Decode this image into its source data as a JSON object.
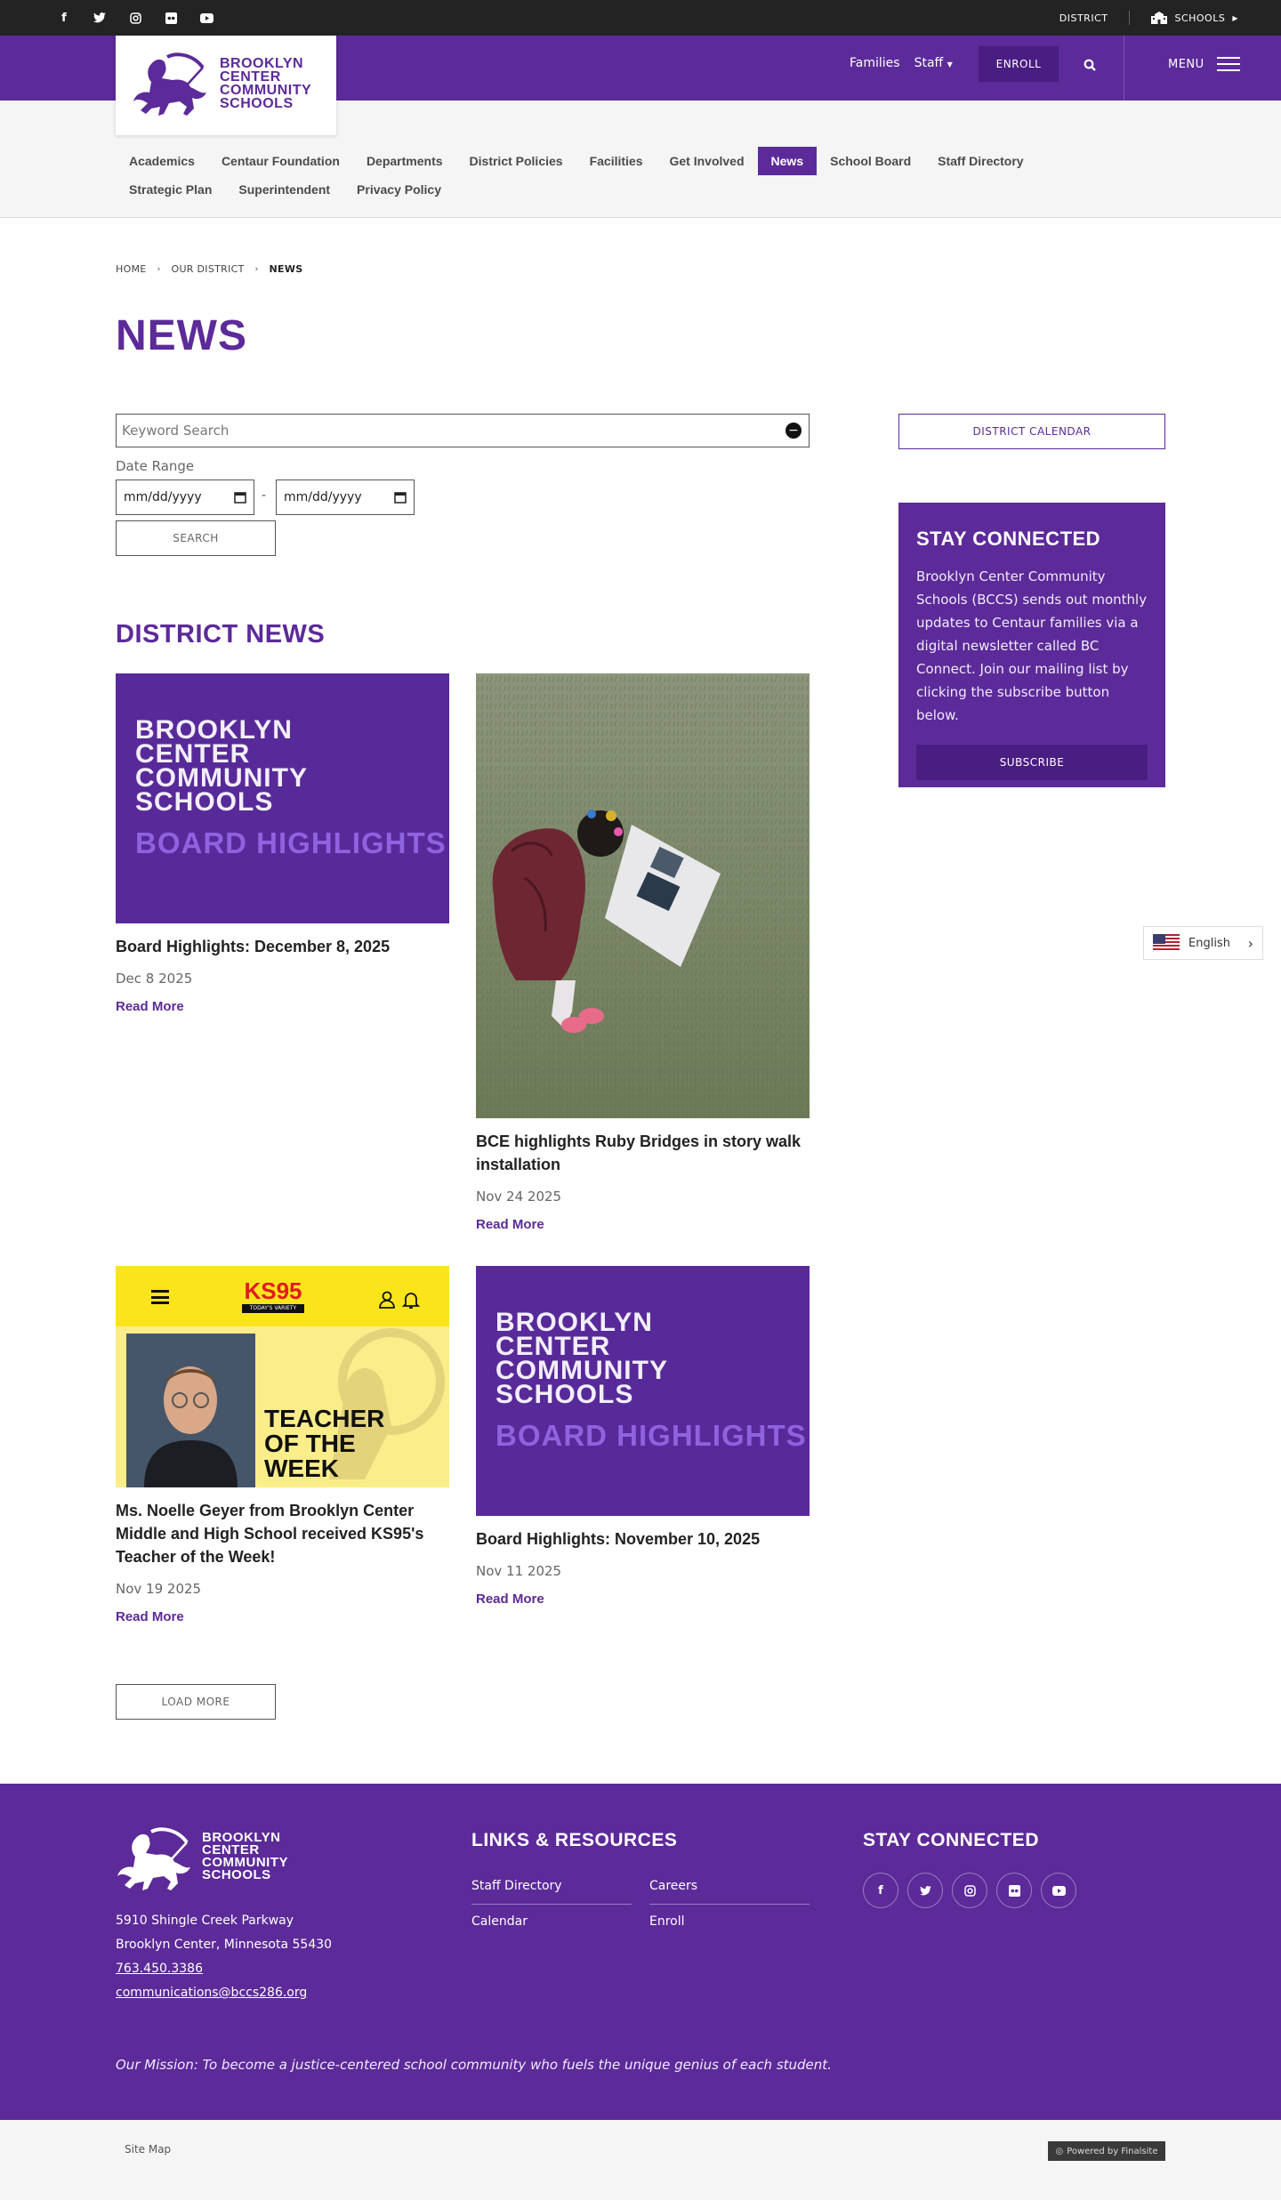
{
  "topbar": {
    "social_icons": [
      "facebook-icon",
      "twitter-icon",
      "instagram-icon",
      "flickr-icon",
      "youtube-icon"
    ],
    "district_label": "DISTRICT",
    "schools_label": "SCHOOLS"
  },
  "header": {
    "logo_lines": [
      "BROOKLYN",
      "CENTER",
      "COMMUNITY",
      "SCHOOLS"
    ],
    "families_label": "Families",
    "staff_label": "Staff",
    "enroll_label": "ENROLL",
    "menu_label": "MENU"
  },
  "subnav": {
    "items": [
      "Academics",
      "Centaur Foundation",
      "Departments",
      "District Policies",
      "Facilities",
      "Get Involved",
      "News",
      "School Board",
      "Staff Directory",
      "Strategic Plan",
      "Superintendent",
      "Privacy Policy"
    ],
    "active": "News"
  },
  "breadcrumb": [
    "HOME",
    "OUR DISTRICT",
    "NEWS"
  ],
  "page_title": "NEWS",
  "search": {
    "keyword_placeholder": "Keyword Search",
    "date_range_label": "Date Range",
    "date_from_placeholder": "mm/dd/yyyy",
    "date_to_placeholder": "mm/dd/yyyy",
    "date_separator": "-",
    "submit_label": "SEARCH"
  },
  "district_news": {
    "title": "DISTRICT NEWS",
    "board_graphic": {
      "lines": [
        "BROOKLYN",
        "CENTER",
        "COMMUNITY",
        "SCHOOLS"
      ],
      "highlight": "BOARD HIGHLIGHTS"
    },
    "teacher_graphic": {
      "station": "KS95",
      "station_tag": "TODAY'S VARIETY",
      "headline_lines": [
        "TEACHER",
        "OF THE",
        "WEEK"
      ]
    },
    "items": [
      {
        "title": "Board Highlights: December 8, 2025",
        "date": "Dec 8 2025",
        "more": "Read More"
      },
      {
        "title": "BCE highlights Ruby Bridges in story walk installation",
        "date": "Nov 24 2025",
        "more": "Read More"
      },
      {
        "title": "Ms. Noelle Geyer from Brooklyn Center Middle and High School received KS95's Teacher of the Week!",
        "date": "Nov 19 2025",
        "more": "Read More"
      },
      {
        "title": "Board Highlights: November 10, 2025",
        "date": "Nov 11 2025",
        "more": "Read More"
      }
    ],
    "load_more_label": "LOAD MORE"
  },
  "sidebar": {
    "calendar_label": "DISTRICT CALENDAR",
    "stay_title": "STAY CONNECTED",
    "stay_text": "Brooklyn Center Community Schools (BCCS) sends out monthly updates to Centaur families via a digital newsletter called BC Connect. Join our mailing list by clicking the subscribe button below.",
    "subscribe_label": "SUBSCRIBE"
  },
  "language": {
    "label": "English"
  },
  "footer": {
    "logo_lines": [
      "BROOKLYN",
      "CENTER",
      "COMMUNITY",
      "SCHOOLS"
    ],
    "address1": "5910 Shingle Creek Parkway",
    "address2": "Brooklyn Center, Minnesota  55430",
    "phone": "763.450.3386",
    "email": "communications@bccs286.org",
    "links_title": "LINKS & RESOURCES",
    "links": [
      "Staff Directory",
      "Careers",
      "Calendar",
      "Enroll"
    ],
    "stay_title": "STAY CONNECTED",
    "social_icons": [
      "facebook-icon",
      "twitter-icon",
      "instagram-icon",
      "flickr-icon",
      "youtube-icon"
    ],
    "mission": "Our Mission: To become a justice-centered school community who fuels the unique genius of each student."
  },
  "bottom": {
    "sitemap_label": "Site Map",
    "powered_label": "Powered by Finalsite"
  },
  "colors": {
    "brand_purple": "#5c2a99",
    "dark_purple": "#4a1d82",
    "topbar": "#232323"
  }
}
